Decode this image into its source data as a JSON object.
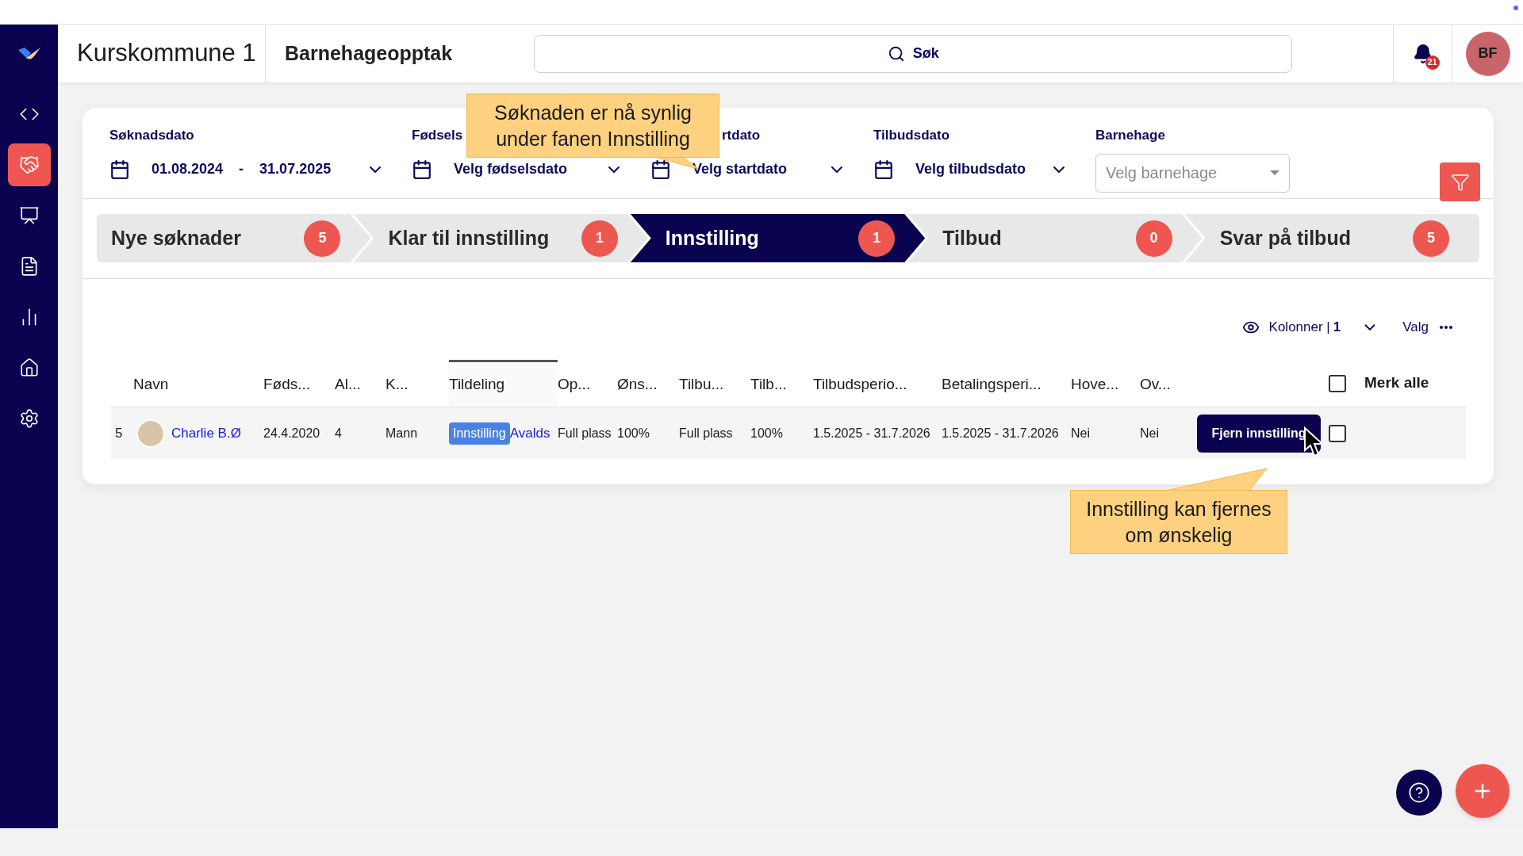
{
  "header": {
    "organisation": "Kurskommune 1",
    "module": "Barnehageopptak",
    "search": {
      "placeholder": "Søk"
    },
    "notifications": "21",
    "user_initials": "BF"
  },
  "sidebar": {
    "items": [
      {
        "selected": false
      },
      {
        "selected": true
      },
      {
        "selected": false
      },
      {
        "selected": false
      },
      {
        "selected": false
      },
      {
        "selected": false
      },
      {
        "selected": false
      }
    ]
  },
  "filters": [
    {
      "kind": "daterange",
      "label": "Søknadsdato",
      "from": "01.08.2024",
      "separator": "-",
      "to": "31.07.2025"
    },
    {
      "kind": "date",
      "label": "Fødsels",
      "value": "Velg fødselsdato"
    },
    {
      "kind": "date",
      "label": "rtdato",
      "value": "Velg startdato"
    },
    {
      "kind": "date",
      "label": "Tilbudsdato",
      "value": "Velg tilbudsdato"
    },
    {
      "kind": "select",
      "label": "Barnehage",
      "placeholder": "Velg barnehage"
    }
  ],
  "stages": [
    {
      "label": "Nye søknader",
      "count": "5",
      "selected": false
    },
    {
      "label": "Klar til innstilling",
      "count": "1",
      "selected": false
    },
    {
      "label": "Innstilling",
      "count": "1",
      "selected": true
    },
    {
      "label": "Tilbud",
      "count": "0",
      "selected": false
    },
    {
      "label": "Svar på tilbud",
      "count": "5",
      "selected": false
    }
  ],
  "toolbar": {
    "columns_label": "Kolonner |",
    "columns_count": "1",
    "options_label": "Valg"
  },
  "table": {
    "columns": [
      {
        "label": "Navn",
        "selected": false
      },
      {
        "label": "Føds...",
        "selected": false
      },
      {
        "label": "Al...",
        "selected": false
      },
      {
        "label": "K...",
        "selected": false
      },
      {
        "label": "Tildeling",
        "selected": true
      },
      {
        "label": "Op...",
        "selected": false
      },
      {
        "label": "Øns...",
        "selected": false
      },
      {
        "label": "Tilbu...",
        "selected": false
      },
      {
        "label": "Tilb...",
        "selected": false
      },
      {
        "label": "Tilbudsperio...",
        "selected": false
      },
      {
        "label": "Betalingsperi...",
        "selected": false
      },
      {
        "label": "Hove...",
        "selected": false
      },
      {
        "label": "Ov...",
        "selected": false
      }
    ],
    "select_all": {
      "label": "Merk alle",
      "checked": false
    },
    "rows": [
      {
        "number": "5",
        "cells": [
          {
            "kind": "person",
            "text": "Charlie B.Ø"
          },
          {
            "kind": "text",
            "text": "24.4.2020"
          },
          {
            "kind": "text",
            "text": "4"
          },
          {
            "kind": "text",
            "text": "Mann"
          },
          {
            "kind": "tag",
            "tag": "Innstilling",
            "text": "Avalds"
          },
          {
            "kind": "text",
            "text": "Full plass"
          },
          {
            "kind": "text",
            "text": "100%"
          },
          {
            "kind": "text",
            "text": "Full plass"
          },
          {
            "kind": "text",
            "text": "100%"
          },
          {
            "kind": "text",
            "text": "1.5.2025 - 31.7.2026"
          },
          {
            "kind": "text",
            "text": "1.5.2025 - 31.7.2026"
          },
          {
            "kind": "text",
            "text": "Nei"
          },
          {
            "kind": "text",
            "text": "Nei"
          }
        ],
        "action": "Fjern innstilling",
        "checked": false
      }
    ]
  },
  "callouts": [
    "Søknaden er nå synlig under fanen Innstilling",
    "Innstilling kan fjernes om ønskelig"
  ]
}
